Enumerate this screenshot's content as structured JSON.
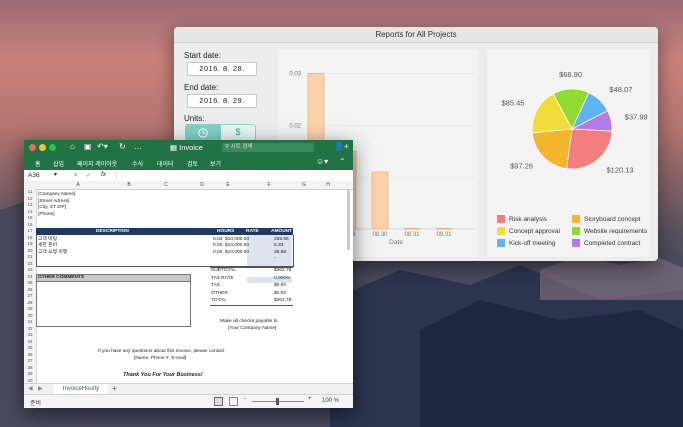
{
  "reports": {
    "title": "Reports for All Projects",
    "start_label": "Start date:",
    "start_value": "2016.  8. 28.",
    "end_label": "End date:",
    "end_value": "2016.  8. 29.",
    "units_label": "Units:",
    "unit_dollar": "$",
    "bar_x_label": "Date",
    "legend": [
      {
        "label": "Risk analysis",
        "color": "#f47e7e"
      },
      {
        "label": "Storyboard concept",
        "color": "#f5b52f"
      },
      {
        "label": "Concept approval",
        "color": "#f2dc3a"
      },
      {
        "label": "Website requirements",
        "color": "#8fdc2e"
      },
      {
        "label": "Kick-off meeting",
        "color": "#5fb3f2"
      },
      {
        "label": "Completed contract",
        "color": "#b57ae6"
      }
    ]
  },
  "chart_data": [
    {
      "type": "bar",
      "categories": [
        "08.28",
        "08.29",
        "08.30",
        "08.31",
        "09.01"
      ],
      "values": [
        0.03,
        0.015,
        0.011,
        0.0,
        0.0
      ],
      "xlabel": "Date",
      "ylim": [
        0,
        0.032
      ],
      "ytick_labels": [
        "0.03",
        "0.02",
        "0.01"
      ],
      "xtick_labels": [
        "08.29",
        "08.30",
        "08.31",
        "09.01"
      ],
      "color": "#fbd1a9"
    },
    {
      "type": "pie",
      "labels": [
        "$120.13",
        "$97.26",
        "$85.45",
        "$66.90",
        "$48.07",
        "$37.99"
      ],
      "values": [
        120.13,
        97.26,
        85.45,
        66.9,
        48.07,
        37.99
      ],
      "colors": [
        "#f47e7e",
        "#f5b52f",
        "#f2dc3a",
        "#8fdc2e",
        "#5fb3f2",
        "#b57ae6"
      ]
    }
  ],
  "excel": {
    "title": "Invoice",
    "search_placeholder": "시트 검색",
    "tabs": [
      "홈",
      "삽입",
      "페이지 레이아웃",
      "수식",
      "데이터",
      "검토",
      "보기"
    ],
    "name_box": "A36",
    "fx": "fx",
    "columns": [
      "A",
      "B",
      "C",
      "D",
      "E",
      "F",
      "G",
      "H"
    ],
    "rows": {
      "r11": "[Company Name]",
      "r12": "[Street Adress]",
      "r13": "[City, ST  ZIP]",
      "r14": "[Phone]"
    },
    "header_description": "DESCRIPTION",
    "header_hours": "HOURS",
    "header_rate": "RATE",
    "header_amount": "AMOUNT",
    "items": [
      {
        "desc": "고객 미팅",
        "hours": "0.03",
        "rate": "$10,000.00",
        "amount": "255.56"
      },
      {
        "desc": "세한 준비",
        "hours": "0.00",
        "rate": "$10,000.00",
        "amount": "8.33"
      },
      {
        "desc": "고객 요청 미행",
        "hours": "0.00",
        "rate": "$10,000.00",
        "amount": "38.89"
      },
      {
        "desc": "",
        "hours": "",
        "rate": "",
        "amount": "-"
      }
    ],
    "row_numbers": [
      "11",
      "12",
      "13",
      "14",
      "15",
      "16",
      "17",
      "18",
      "19",
      "20",
      "21",
      "22",
      "23",
      "24",
      "25",
      "26",
      "27",
      "28",
      "29",
      "30",
      "31",
      "32",
      "33",
      "34",
      "35",
      "36",
      "37",
      "38",
      "39",
      "40"
    ],
    "totals": [
      {
        "label": "SUBTOTAL",
        "value": "$302.78"
      },
      {
        "label": "TAX RATE",
        "value": "0.000%"
      },
      {
        "label": "TAX",
        "value": "$0.00"
      },
      {
        "label": "OTHER",
        "value": "$0.00"
      },
      {
        "label": "TOTAL",
        "value": "$302.78"
      }
    ],
    "other_comments": "OTHER COMMENTS",
    "payable_line1": "Make all checks payable to",
    "payable_line2": "[Your Company Name]",
    "questions_line": "If you have any questions about this invoice, please contact",
    "contact_line": "[Name, Phone #, E-mail]",
    "thanks": "Thank You For Your Business!",
    "sheet_tab": "InvoiceHourly",
    "add_sheet": "+",
    "status_ready": "준비",
    "zoom": "100 %"
  }
}
